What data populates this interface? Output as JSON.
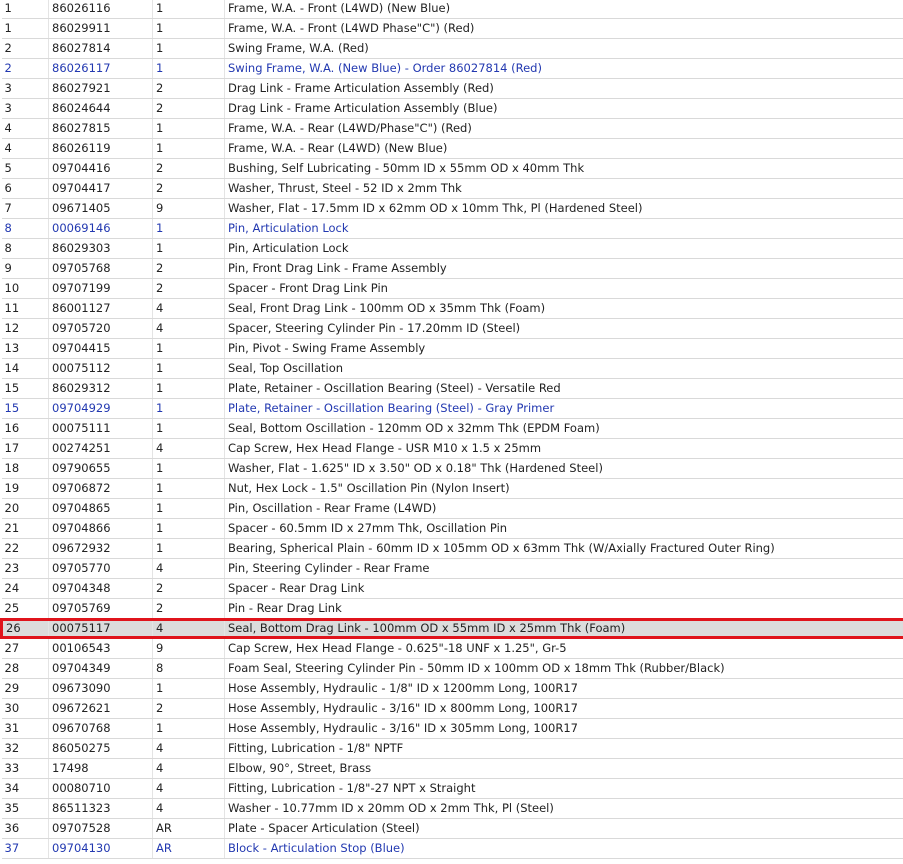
{
  "colors": {
    "link": "#2238b0",
    "text": "#222222",
    "selected_bg": "#dcdcdc",
    "highlight_border": "#e0141c"
  },
  "parts_table": {
    "selected_row_index": 31,
    "rows": [
      {
        "ref": "1",
        "part": "86026116",
        "qty": "1",
        "desc": "Frame, W.A. - Front (L4WD) (New Blue)",
        "link": false
      },
      {
        "ref": "1",
        "part": "86029911",
        "qty": "1",
        "desc": "Frame, W.A. - Front (L4WD Phase\"C\") (Red)",
        "link": false
      },
      {
        "ref": "2",
        "part": "86027814",
        "qty": "1",
        "desc": "Swing Frame, W.A. (Red)",
        "link": false
      },
      {
        "ref": "2",
        "part": "86026117",
        "qty": "1",
        "desc": "Swing Frame, W.A. (New Blue) - Order 86027814 (Red)",
        "link": true
      },
      {
        "ref": "3",
        "part": "86027921",
        "qty": "2",
        "desc": "Drag Link - Frame Articulation Assembly (Red)",
        "link": false
      },
      {
        "ref": "3",
        "part": "86024644",
        "qty": "2",
        "desc": "Drag Link - Frame Articulation Assembly (Blue)",
        "link": false
      },
      {
        "ref": "4",
        "part": "86027815",
        "qty": "1",
        "desc": "Frame, W.A. - Rear (L4WD/Phase\"C\") (Red)",
        "link": false
      },
      {
        "ref": "4",
        "part": "86026119",
        "qty": "1",
        "desc": "Frame, W.A. - Rear (L4WD) (New Blue)",
        "link": false
      },
      {
        "ref": "5",
        "part": "09704416",
        "qty": "2",
        "desc": "Bushing, Self Lubricating - 50mm ID x 55mm OD x 40mm Thk",
        "link": false
      },
      {
        "ref": "6",
        "part": "09704417",
        "qty": "2",
        "desc": "Washer, Thrust, Steel - 52 ID x 2mm Thk",
        "link": false
      },
      {
        "ref": "7",
        "part": "09671405",
        "qty": "9",
        "desc": "Washer, Flat - 17.5mm ID x 62mm OD x 10mm Thk, Pl (Hardened Steel)",
        "link": false
      },
      {
        "ref": "8",
        "part": "00069146",
        "qty": "1",
        "desc": "Pin, Articulation Lock",
        "link": true
      },
      {
        "ref": "8",
        "part": "86029303",
        "qty": "1",
        "desc": "Pin, Articulation Lock",
        "link": false
      },
      {
        "ref": "9",
        "part": "09705768",
        "qty": "2",
        "desc": "Pin, Front Drag Link - Frame Assembly",
        "link": false
      },
      {
        "ref": "10",
        "part": "09707199",
        "qty": "2",
        "desc": "Spacer - Front Drag Link Pin",
        "link": false
      },
      {
        "ref": "11",
        "part": "86001127",
        "qty": "4",
        "desc": "Seal, Front Drag Link - 100mm OD x 35mm Thk (Foam)",
        "link": false
      },
      {
        "ref": "12",
        "part": "09705720",
        "qty": "4",
        "desc": "Spacer, Steering Cylinder Pin - 17.20mm ID (Steel)",
        "link": false
      },
      {
        "ref": "13",
        "part": "09704415",
        "qty": "1",
        "desc": "Pin, Pivot - Swing Frame Assembly",
        "link": false
      },
      {
        "ref": "14",
        "part": "00075112",
        "qty": "1",
        "desc": "Seal, Top Oscillation",
        "link": false
      },
      {
        "ref": "15",
        "part": "86029312",
        "qty": "1",
        "desc": "Plate, Retainer - Oscillation Bearing (Steel) - Versatile Red",
        "link": false
      },
      {
        "ref": "15",
        "part": "09704929",
        "qty": "1",
        "desc": "Plate, Retainer - Oscillation Bearing (Steel) - Gray Primer",
        "link": true
      },
      {
        "ref": "16",
        "part": "00075111",
        "qty": "1",
        "desc": "Seal, Bottom Oscillation - 120mm OD x 32mm Thk (EPDM Foam)",
        "link": false
      },
      {
        "ref": "17",
        "part": "00274251",
        "qty": "4",
        "desc": "Cap Screw, Hex Head Flange - USR M10 x 1.5 x 25mm",
        "link": false
      },
      {
        "ref": "18",
        "part": "09790655",
        "qty": "1",
        "desc": "Washer, Flat - 1.625\" ID x 3.50\" OD x 0.18\" Thk (Hardened Steel)",
        "link": false
      },
      {
        "ref": "19",
        "part": "09706872",
        "qty": "1",
        "desc": "Nut, Hex Lock - 1.5\" Oscillation Pin (Nylon Insert)",
        "link": false
      },
      {
        "ref": "20",
        "part": "09704865",
        "qty": "1",
        "desc": "Pin, Oscillation - Rear Frame (L4WD)",
        "link": false
      },
      {
        "ref": "21",
        "part": "09704866",
        "qty": "1",
        "desc": "Spacer - 60.5mm ID x 27mm Thk, Oscillation Pin",
        "link": false
      },
      {
        "ref": "22",
        "part": "09672932",
        "qty": "1",
        "desc": "Bearing, Spherical Plain - 60mm ID x 105mm OD x 63mm Thk (W/Axially Fractured Outer Ring)",
        "link": false
      },
      {
        "ref": "23",
        "part": "09705770",
        "qty": "4",
        "desc": "Pin, Steering Cylinder - Rear Frame",
        "link": false
      },
      {
        "ref": "24",
        "part": "09704348",
        "qty": "2",
        "desc": "Spacer - Rear Drag Link",
        "link": false
      },
      {
        "ref": "25",
        "part": "09705769",
        "qty": "2",
        "desc": "Pin - Rear Drag Link",
        "link": false
      },
      {
        "ref": "26",
        "part": "00075117",
        "qty": "4",
        "desc": "Seal, Bottom Drag Link - 100mm OD x 55mm ID x 25mm Thk (Foam)",
        "link": false
      },
      {
        "ref": "27",
        "part": "00106543",
        "qty": "9",
        "desc": "Cap Screw, Hex Head Flange - 0.625\"-18 UNF x 1.25\", Gr-5",
        "link": false
      },
      {
        "ref": "28",
        "part": "09704349",
        "qty": "8",
        "desc": "Foam Seal, Steering Cylinder Pin - 50mm ID x 100mm OD x 18mm Thk (Rubber/Black)",
        "link": false
      },
      {
        "ref": "29",
        "part": "09673090",
        "qty": "1",
        "desc": "Hose Assembly, Hydraulic - 1/8\" ID x 1200mm Long, 100R17",
        "link": false
      },
      {
        "ref": "30",
        "part": "09672621",
        "qty": "2",
        "desc": "Hose Assembly, Hydraulic - 3/16\" ID x 800mm Long, 100R17",
        "link": false
      },
      {
        "ref": "31",
        "part": "09670768",
        "qty": "1",
        "desc": "Hose Assembly, Hydraulic - 3/16\" ID x 305mm Long, 100R17",
        "link": false
      },
      {
        "ref": "32",
        "part": "86050275",
        "qty": "4",
        "desc": "Fitting, Lubrication - 1/8\" NPTF",
        "link": false
      },
      {
        "ref": "33",
        "part": "17498",
        "qty": "4",
        "desc": "Elbow, 90°, Street, Brass",
        "link": false
      },
      {
        "ref": "34",
        "part": "00080710",
        "qty": "4",
        "desc": "Fitting, Lubrication - 1/8\"-27 NPT x Straight",
        "link": false
      },
      {
        "ref": "35",
        "part": "86511323",
        "qty": "4",
        "desc": "Washer - 10.77mm ID x 20mm OD x 2mm Thk, Pl (Steel)",
        "link": false
      },
      {
        "ref": "36",
        "part": "09707528",
        "qty": "AR",
        "desc": "Plate - Spacer Articulation (Steel)",
        "link": false
      },
      {
        "ref": "37",
        "part": "09704130",
        "qty": "AR",
        "desc": "Block - Articulation Stop (Blue)",
        "link": true
      }
    ]
  }
}
